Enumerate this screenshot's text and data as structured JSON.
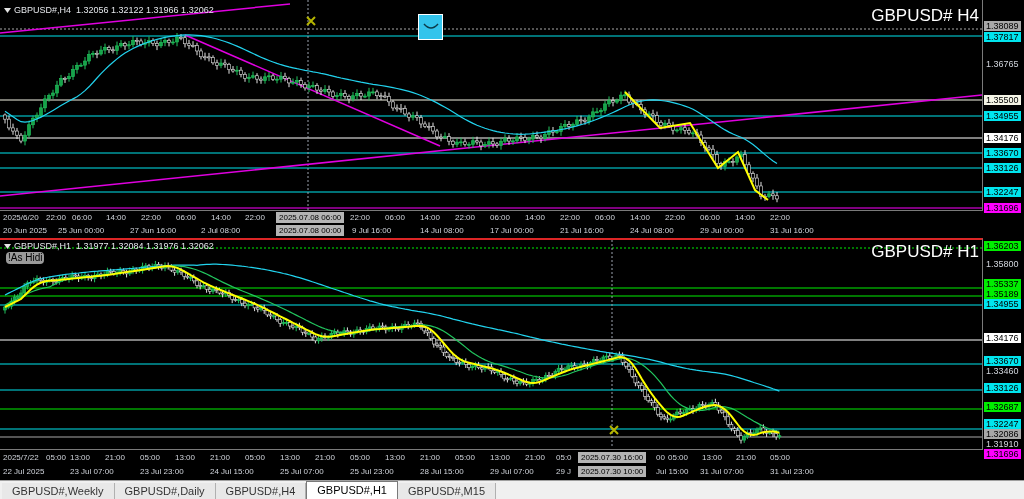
{
  "top_panel": {
    "header": "GBPUSD#,H4  1.32056 1.32122 1.31966 1.32062",
    "chart_title": "GBPUSD# H4",
    "price_labels": [
      {
        "text": "1.38089",
        "kind": "level",
        "color": "#a8a8a8"
      },
      {
        "text": "1.37817",
        "kind": "level",
        "color": "#00e5ee"
      },
      {
        "text": "1.36765",
        "kind": "tick"
      },
      {
        "text": "1.35500",
        "kind": "level",
        "color": "#f5f5e6"
      },
      {
        "text": "1.34955",
        "kind": "level",
        "color": "#00e5ee"
      },
      {
        "text": "1.34176",
        "kind": "level",
        "color": "#ffffff"
      },
      {
        "text": "1.33670",
        "kind": "level",
        "color": "#00e5ee"
      },
      {
        "text": "1.33126",
        "kind": "level",
        "color": "#00e5ee"
      },
      {
        "text": "1.32247",
        "kind": "level",
        "color": "#00e5ee"
      },
      {
        "text": "1.31696",
        "kind": "level",
        "color": "#ff00ff"
      }
    ],
    "time_axis": {
      "row_1": [
        {
          "text": "2025/6/20",
          "kind": "tick"
        },
        {
          "text": "22:00",
          "kind": "tick"
        },
        {
          "text": "06:00",
          "kind": "tick"
        },
        {
          "text": "14:00",
          "kind": "tick"
        },
        {
          "text": "22:00",
          "kind": "tick"
        },
        {
          "text": "06:00",
          "kind": "tick"
        },
        {
          "text": "14:00",
          "kind": "tick"
        },
        {
          "text": "22:00",
          "kind": "tick"
        },
        {
          "text": "2025.07.08 06:00",
          "kind": "cursor"
        },
        {
          "text": "22:00",
          "kind": "tick"
        },
        {
          "text": "06:00",
          "kind": "tick"
        },
        {
          "text": "14:00",
          "kind": "tick"
        },
        {
          "text": "22:00",
          "kind": "tick"
        },
        {
          "text": "06:00",
          "kind": "tick"
        },
        {
          "text": "14:00",
          "kind": "tick"
        },
        {
          "text": "22:00",
          "kind": "tick"
        },
        {
          "text": "06:00",
          "kind": "tick"
        },
        {
          "text": "14:00",
          "kind": "tick"
        },
        {
          "text": "22:00",
          "kind": "tick"
        },
        {
          "text": "06:00",
          "kind": "tick"
        },
        {
          "text": "14:00",
          "kind": "tick"
        },
        {
          "text": "22:00",
          "kind": "tick"
        }
      ],
      "row_2": [
        {
          "text": "20 Jun 2025",
          "kind": "tick"
        },
        {
          "text": "25 Jun 00:00",
          "kind": "tick"
        },
        {
          "text": "27 Jun 16:00",
          "kind": "tick"
        },
        {
          "text": "2 Jul 08:00",
          "kind": "tick"
        },
        {
          "text": "2025.07.08 00:00",
          "kind": "cursor"
        },
        {
          "text": "9 Jul 16:00",
          "kind": "tick"
        },
        {
          "text": "14 Jul 08:00",
          "kind": "tick"
        },
        {
          "text": "17 Jul 00:00",
          "kind": "tick"
        },
        {
          "text": "21 Jul 16:00",
          "kind": "tick"
        },
        {
          "text": "24 Jul 08:00",
          "kind": "tick"
        },
        {
          "text": "29 Jul 00:00",
          "kind": "tick"
        },
        {
          "text": "31 Jul 16:00",
          "kind": "tick"
        }
      ]
    }
  },
  "bottom_panel": {
    "header": "GBPUSD#,H1  1.31977 1.32084 1.31976 1.32062",
    "chart_title": "GBPUSD# H1",
    "button": "!As Hidi",
    "price_labels": [
      {
        "text": "1.36203",
        "kind": "level",
        "color": "#00ee00"
      },
      {
        "text": "1.35800",
        "kind": "tick"
      },
      {
        "text": "1.35337",
        "kind": "level",
        "color": "#00ee00"
      },
      {
        "text": "1.35189",
        "kind": "level",
        "color": "#00ee00"
      },
      {
        "text": "1.34955",
        "kind": "level",
        "color": "#00e5ee"
      },
      {
        "text": "1.34176",
        "kind": "level",
        "color": "#ffffff"
      },
      {
        "text": "1.33670",
        "kind": "level",
        "color": "#00e5ee"
      },
      {
        "text": "1.33460",
        "kind": "tick"
      },
      {
        "text": "1.33126",
        "kind": "level",
        "color": "#00e5ee"
      },
      {
        "text": "1.32687",
        "kind": "level",
        "color": "#00ee00"
      },
      {
        "text": "1.32247",
        "kind": "level",
        "color": "#00e5ee"
      },
      {
        "text": "1.32086",
        "kind": "level",
        "color": "#a8a8a8"
      },
      {
        "text": "1.31910",
        "kind": "tick"
      },
      {
        "text": "1.31696",
        "kind": "level",
        "color": "#ff00ff"
      }
    ],
    "time_axis": {
      "row_1": [
        {
          "text": "2025/7/22",
          "kind": "tick"
        },
        {
          "text": "05:00",
          "kind": "tick"
        },
        {
          "text": "13:00",
          "kind": "tick"
        },
        {
          "text": "21:00",
          "kind": "tick"
        },
        {
          "text": "05:00",
          "kind": "tick"
        },
        {
          "text": "13:00",
          "kind": "tick"
        },
        {
          "text": "21:00",
          "kind": "tick"
        },
        {
          "text": "05:00",
          "kind": "tick"
        },
        {
          "text": "13:00",
          "kind": "tick"
        },
        {
          "text": "21:00",
          "kind": "tick"
        },
        {
          "text": "05:00",
          "kind": "tick"
        },
        {
          "text": "13:00",
          "kind": "tick"
        },
        {
          "text": "21:00",
          "kind": "tick"
        },
        {
          "text": "05:00",
          "kind": "tick"
        },
        {
          "text": "13:00",
          "kind": "tick"
        },
        {
          "text": "21:00",
          "kind": "tick"
        },
        {
          "text": "05:0",
          "kind": "tick"
        },
        {
          "text": "2025.07.30 16:00",
          "kind": "cursor"
        },
        {
          "text": "00",
          "kind": "tick"
        },
        {
          "text": "05:00",
          "kind": "tick"
        },
        {
          "text": "13:00",
          "kind": "tick"
        },
        {
          "text": "21:00",
          "kind": "tick"
        },
        {
          "text": "05:00",
          "kind": "tick"
        }
      ],
      "row_2": [
        {
          "text": "22 Jul 2025",
          "kind": "tick"
        },
        {
          "text": "23 Jul 07:00",
          "kind": "tick"
        },
        {
          "text": "23 Jul 23:00",
          "kind": "tick"
        },
        {
          "text": "24 Jul 15:00",
          "kind": "tick"
        },
        {
          "text": "25 Jul 07:00",
          "kind": "tick"
        },
        {
          "text": "25 Jul 23:00",
          "kind": "tick"
        },
        {
          "text": "28 Jul 15:00",
          "kind": "tick"
        },
        {
          "text": "29 Jul 07:00",
          "kind": "tick"
        },
        {
          "text": "29 J",
          "kind": "tick"
        },
        {
          "text": "2025.07.30 10:00",
          "kind": "cursor"
        },
        {
          "text": "Jul 15:00",
          "kind": "tick"
        },
        {
          "text": "31 Jul 07:00",
          "kind": "tick"
        },
        {
          "text": "31 Jul 23:00",
          "kind": "tick"
        }
      ]
    }
  },
  "tabs": [
    {
      "label": "GBPUSD#,Weekly",
      "selected": false
    },
    {
      "label": "GBPUSD#,Daily",
      "selected": false
    },
    {
      "label": "GBPUSD#,H4",
      "selected": false
    },
    {
      "label": "GBPUSD#,H1",
      "selected": true
    },
    {
      "label": "GBPUSD#,M15",
      "selected": false
    }
  ]
}
